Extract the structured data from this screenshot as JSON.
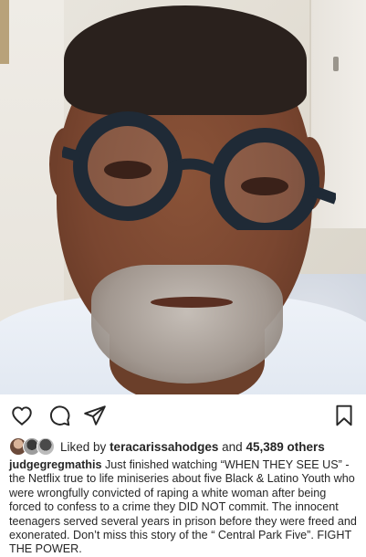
{
  "post": {
    "username": "judgegregmathis",
    "caption": "Just finished watching “WHEN THEY SEE US” - the Netflix true to life miniseries about five Black & Latino Youth who were wrongfully convicted of raping a white woman after being forced to confess to a crime they DID NOT commit. The innocent teenagers served several years in prison before they were freed and exonerated. Don’t miss this story of the “ Central Park Five”. FIGHT THE POWER."
  },
  "likes": {
    "prefix": "Liked by",
    "user": "teracarissahodges",
    "joiner": "and",
    "count": "45,389 others"
  },
  "actions": {
    "like": "heart-icon",
    "comment": "comment-icon",
    "share": "send-icon",
    "save": "bookmark-icon"
  },
  "colors": {
    "text": "#262626",
    "icon": "#262626",
    "background": "#ffffff"
  }
}
